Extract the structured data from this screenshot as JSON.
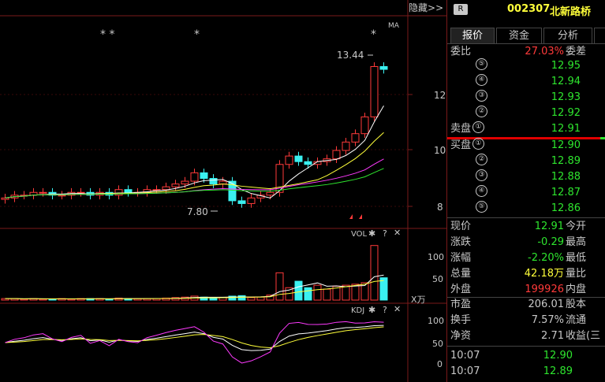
{
  "header": {
    "hide_label": "隐藏",
    "hide_arrows": ">>",
    "badge": "R",
    "stock_code": "002307",
    "stock_name": "北新路桥"
  },
  "tabs": [
    {
      "label": "报价",
      "active": true
    },
    {
      "label": "资金",
      "active": false
    },
    {
      "label": "分析",
      "active": false
    }
  ],
  "order_book": {
    "ratio_label": "委比",
    "ratio_value": "27.03%",
    "diff_label": "委差",
    "sell_label": "卖盘",
    "buy_label": "买盘",
    "sell": [
      {
        "level": "⑤",
        "price": "12.95"
      },
      {
        "level": "④",
        "price": "12.94"
      },
      {
        "level": "③",
        "price": "12.93"
      },
      {
        "level": "②",
        "price": "12.92"
      },
      {
        "level": "①",
        "price": "12.91"
      }
    ],
    "buy": [
      {
        "level": "①",
        "price": "12.90"
      },
      {
        "level": "②",
        "price": "12.89"
      },
      {
        "level": "③",
        "price": "12.88"
      },
      {
        "level": "④",
        "price": "12.87"
      },
      {
        "level": "⑤",
        "price": "12.86"
      }
    ]
  },
  "stats": [
    {
      "label": "现价",
      "value": "12.91",
      "value_color": "green",
      "label2": "今开"
    },
    {
      "label": "涨跌",
      "value": "-0.29",
      "value_color": "green",
      "label2": "最高"
    },
    {
      "label": "涨幅",
      "value": "-2.20%",
      "value_color": "green",
      "label2": "最低"
    },
    {
      "label": "总量",
      "value": "42.18万",
      "value_color": "yellow",
      "label2": "量比"
    },
    {
      "label": "外盘",
      "value": "199926",
      "value_color": "red",
      "label2": "内盘"
    }
  ],
  "fundamentals": [
    {
      "label": "市盈",
      "value": "206.01",
      "label2": "股本"
    },
    {
      "label": "换手",
      "value": "7.57%",
      "label2": "流通"
    },
    {
      "label": "净资",
      "value": "2.71",
      "label2": "收益(三"
    }
  ],
  "ticks": [
    {
      "time": "10:07",
      "price": "12.90"
    },
    {
      "time": "10:07",
      "price": "12.89"
    }
  ],
  "chart": {
    "ma_label": "MA",
    "price_high_label": "13.44",
    "price_low_label": "7.80",
    "axis_labels": [
      "12",
      "10",
      "8"
    ],
    "vol_label": "VOL",
    "vol_axis": [
      "100",
      "50"
    ],
    "vol_unit": "X万",
    "kdj_label": "KDJ",
    "kdj_axis": [
      "100",
      "50",
      "0"
    ],
    "stars": [
      "* *",
      "*",
      "*"
    ],
    "colors": {
      "up": "#ff3a3a",
      "down": "#3af0f0",
      "ma5": "#ffffff",
      "ma10": "#ffff3a",
      "ma20": "#ff3aff",
      "ma60": "#2ee52e"
    }
  },
  "chart_data": {
    "type": "candlestick",
    "title": "",
    "series": [
      {
        "name": "close",
        "values": [
          8.3,
          8.4,
          8.4,
          8.5,
          8.5,
          8.4,
          8.4,
          8.5,
          8.5,
          8.4,
          8.5,
          8.4,
          8.6,
          8.5,
          8.5,
          8.6,
          8.6,
          8.7,
          8.8,
          8.9,
          9.2,
          9.0,
          8.8,
          8.9,
          8.2,
          8.1,
          8.3,
          8.4,
          8.5,
          9.5,
          9.8,
          9.6,
          9.5,
          9.6,
          9.7,
          10.0,
          10.3,
          10.6,
          11.2,
          13.0,
          12.9
        ]
      }
    ],
    "volume": [
      3,
      3,
      2,
      3,
      2,
      2,
      3,
      2,
      3,
      3,
      3,
      2,
      4,
      3,
      3,
      3,
      3,
      4,
      5,
      6,
      8,
      6,
      4,
      5,
      8,
      9,
      5,
      6,
      10,
      55,
      25,
      38,
      25,
      30,
      22,
      28,
      30,
      32,
      35,
      110,
      45
    ]
  }
}
